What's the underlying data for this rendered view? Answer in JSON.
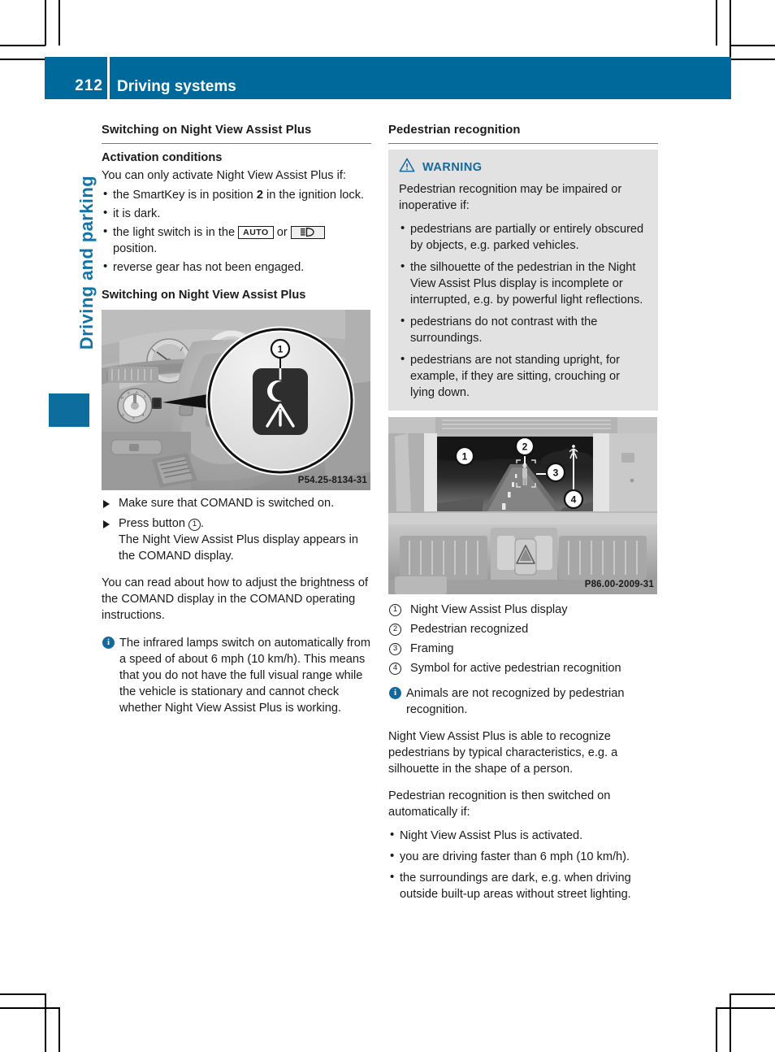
{
  "page": {
    "number": "212",
    "chapter_title": "Driving systems",
    "side_tab": "Driving and parking",
    "accent_blue": "#00699c",
    "tab_blue": "#0d6e9e",
    "note_blue": "#12699b",
    "warn_bg": "#e2e2e2"
  },
  "left_column": {
    "section_title": "Switching on Night View Assist Plus",
    "sub1_title": "Activation conditions",
    "sub1_intro": "You can only activate Night View Assist Plus if:",
    "conditions": [
      {
        "pre": "the SmartKey is in position ",
        "bold": "2",
        "post": " in the ignition lock."
      },
      {
        "pre": "it is dark.",
        "bold": "",
        "post": ""
      },
      {
        "pre": "the light switch is in the ",
        "key_auto": "AUTO",
        "mid": " or ",
        "key_lamp": "low-beam-icon",
        "post": " position."
      },
      {
        "pre": "reverse gear has not been engaged.",
        "bold": "",
        "post": ""
      }
    ],
    "sub2_title": "Switching on Night View Assist Plus",
    "figure": {
      "code": "P54.25-8134-31",
      "callout": "1",
      "alt": "Dashboard view with Night View Assist Plus button magnified"
    },
    "steps": [
      {
        "text_pre": "Make sure that COMAND is switched on.",
        "num": "",
        "text_post": "",
        "result": ""
      },
      {
        "text_pre": "Press button ",
        "num": "1",
        "text_post": ".",
        "result": "The Night View Assist Plus display appears in the COMAND display."
      }
    ],
    "paragraph": "You can read about how to adjust the brightness of the COMAND display in the COMAND operating instructions.",
    "note": "The infrared lamps switch on automatically from a speed of about 6 mph (10 km/h). This means that you do not have the full visual range while the vehicle is stationary and cannot check whether Night View Assist Plus is working."
  },
  "right_column": {
    "section_title": "Pedestrian recognition",
    "warning": {
      "label": "WARNING",
      "icon": "warning-triangle-icon",
      "intro": "Pedestrian recognition may be impaired or inoperative if:",
      "bullets": [
        "pedestrians are partially or entirely obscured by objects, e.g. parked vehicles.",
        "the silhouette of the pedestrian in the Night View Assist Plus display is incomplete or interrupted, e.g. by powerful light reflections.",
        "pedestrians do not contrast with the surroundings.",
        "pedestrians are not standing upright, for example, if they are sitting, crouching or lying down."
      ]
    },
    "figure": {
      "code": "P86.00-2009-31",
      "callouts": [
        "1",
        "2",
        "3",
        "4"
      ],
      "alt": "Night View Assist Plus display in instrument cluster showing recognized pedestrian"
    },
    "legend": [
      {
        "num": "1",
        "text": "Night View Assist Plus display"
      },
      {
        "num": "2",
        "text": "Pedestrian recognized"
      },
      {
        "num": "3",
        "text": "Framing"
      },
      {
        "num": "4",
        "text": "Symbol for active pedestrian recognition"
      }
    ],
    "note": "Animals are not recognized by pedestrian recognition.",
    "paragraph1": "Night View Assist Plus is able to recognize pedestrians by typical characteristics, e.g. a silhouette in the shape of a person.",
    "paragraph2": "Pedestrian recognition is then switched on automatically if:",
    "bullets": [
      "Night View Assist Plus is activated.",
      "you are driving faster than 6 mph (10 km/h).",
      "the surroundings are dark, e.g. when driving outside built-up areas without street lighting."
    ]
  }
}
